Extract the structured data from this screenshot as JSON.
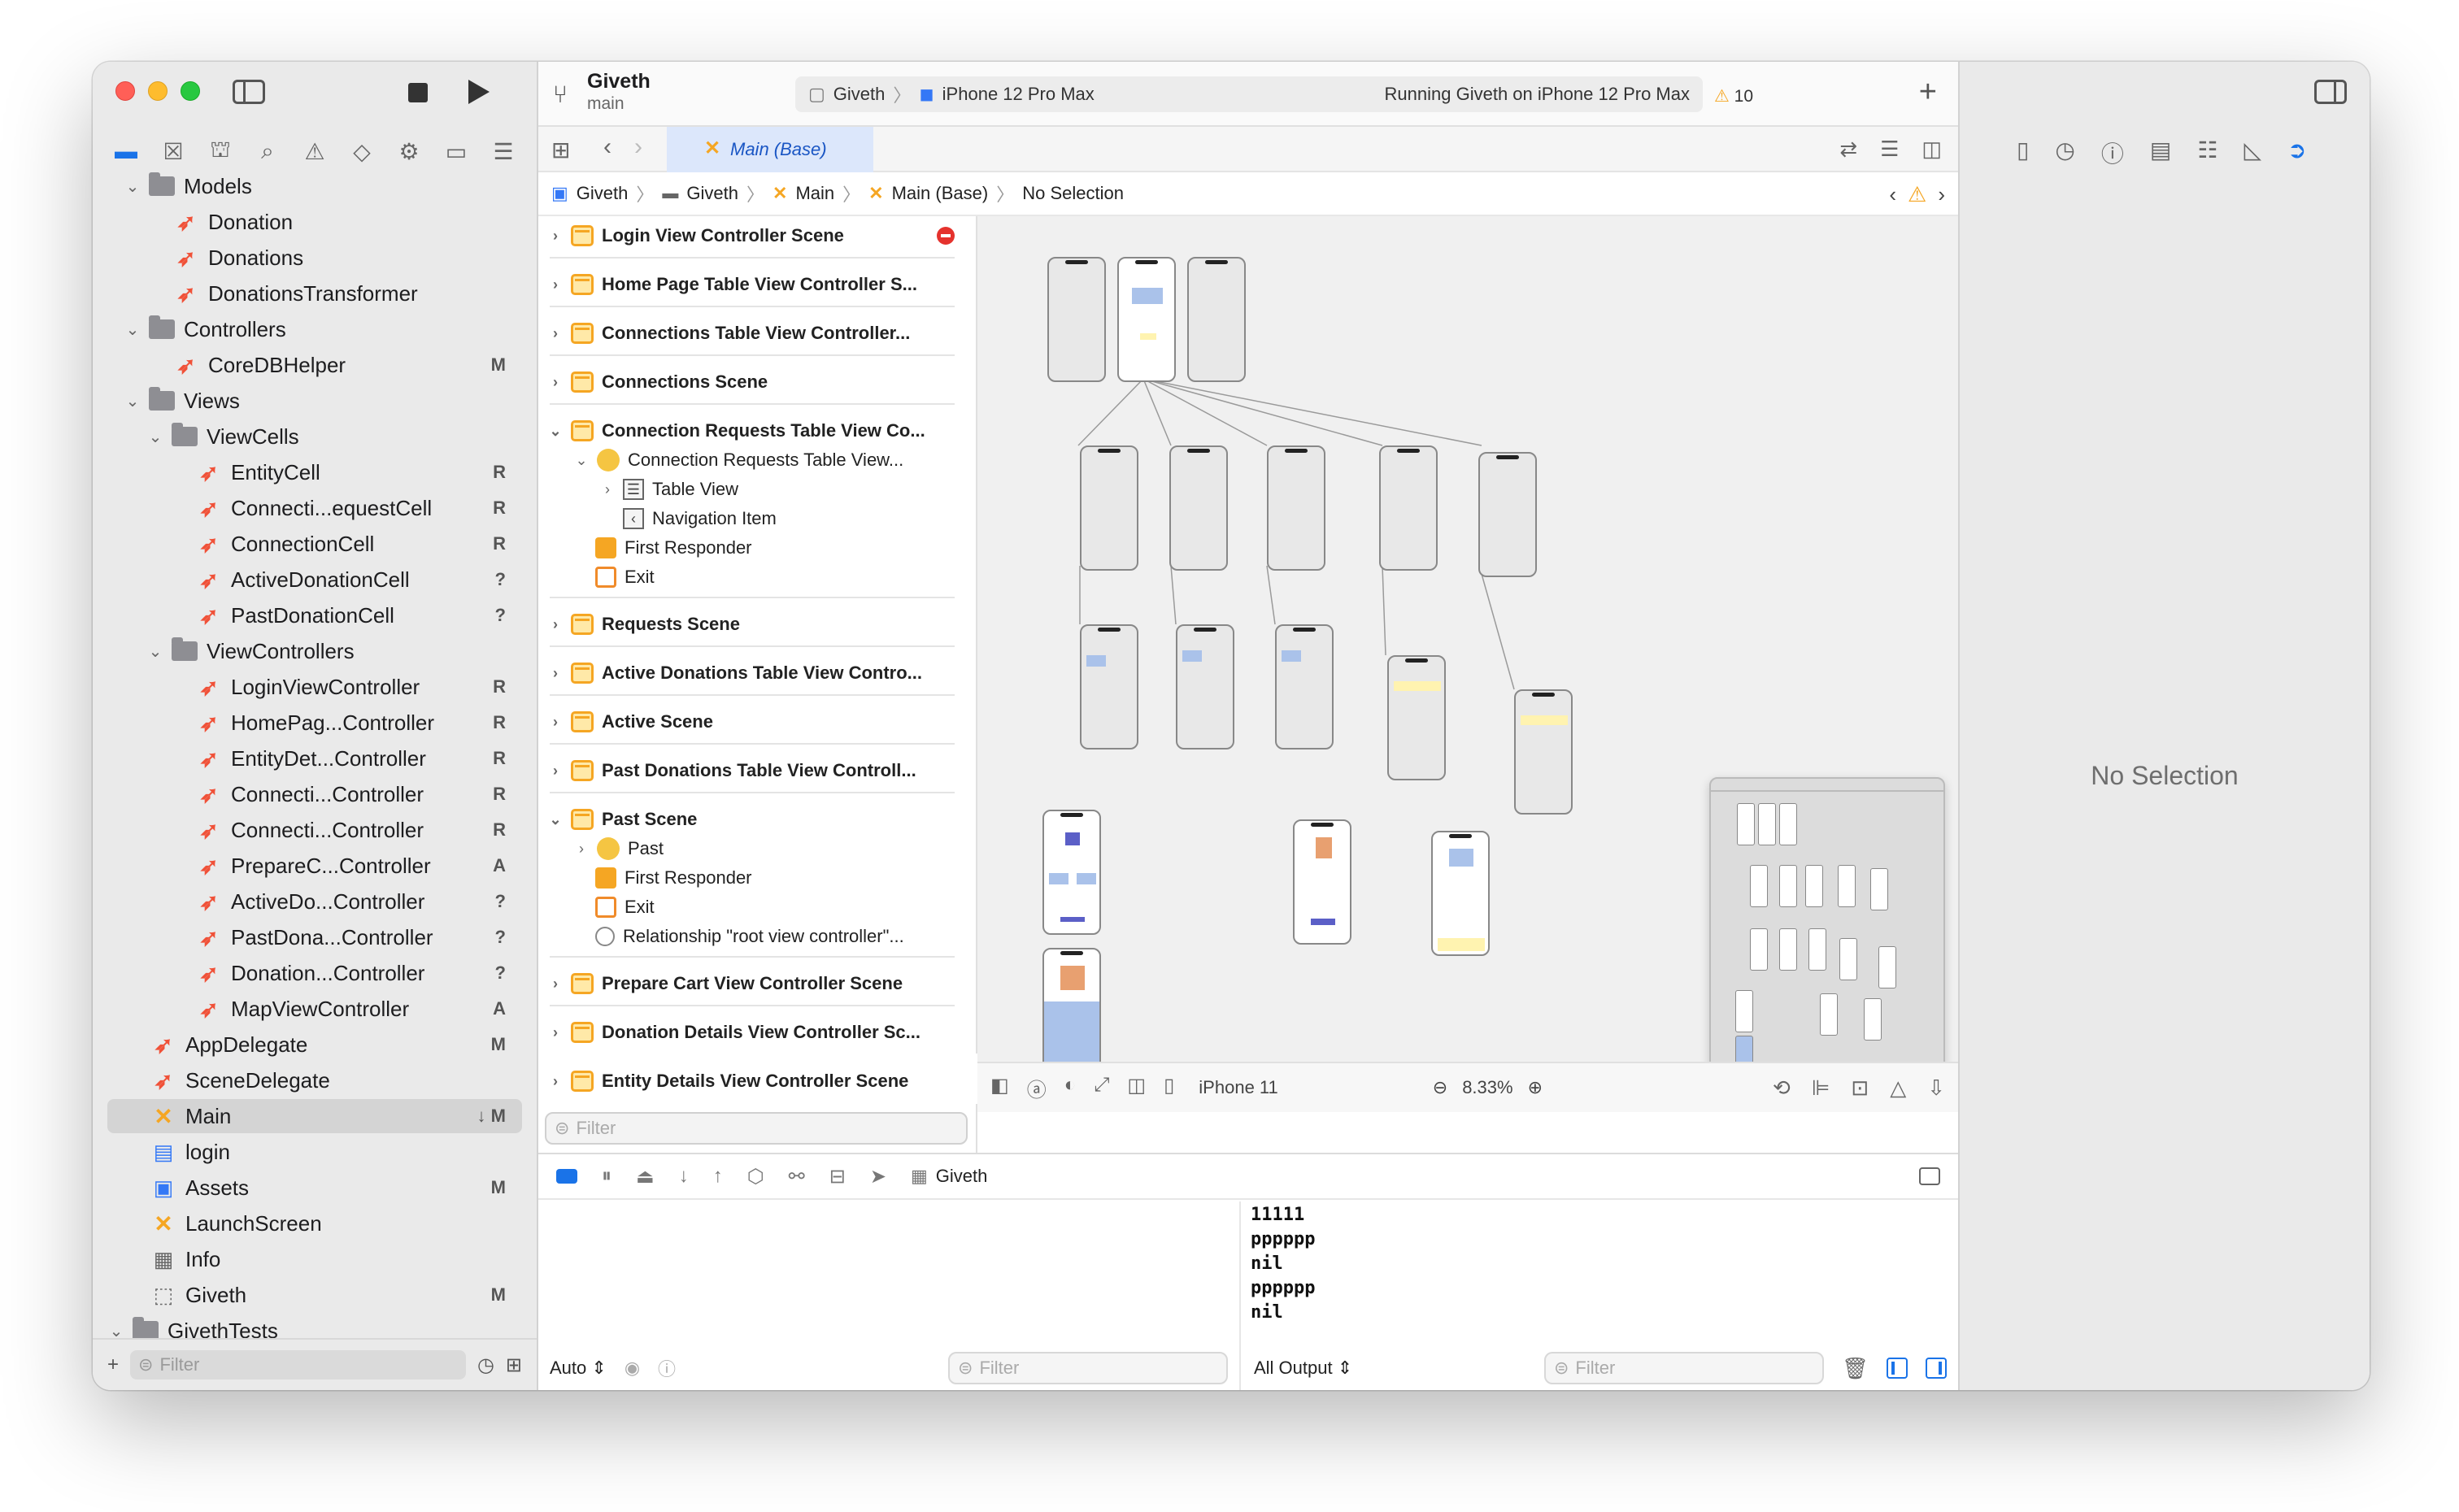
{
  "toolbar": {
    "project_name": "Giveth",
    "branch": "main",
    "scheme": "Giveth",
    "device": "iPhone 12 Pro Max",
    "status": "Running Giveth on iPhone 12 Pro Max",
    "warning_count": "10"
  },
  "navigator": {
    "filter_placeholder": "Filter",
    "items": [
      {
        "label": "Models",
        "kind": "folder",
        "indent": 1,
        "expanded": true,
        "badge": ""
      },
      {
        "label": "Donation",
        "kind": "swift",
        "indent": 2,
        "badge": ""
      },
      {
        "label": "Donations",
        "kind": "swift",
        "indent": 2,
        "badge": ""
      },
      {
        "label": "DonationsTransformer",
        "kind": "swift",
        "indent": 2,
        "badge": ""
      },
      {
        "label": "Controllers",
        "kind": "folder",
        "indent": 1,
        "expanded": true,
        "badge": ""
      },
      {
        "label": "CoreDBHelper",
        "kind": "swift",
        "indent": 2,
        "badge": "M"
      },
      {
        "label": "Views",
        "kind": "folder",
        "indent": 1,
        "expanded": true,
        "badge": ""
      },
      {
        "label": "ViewCells",
        "kind": "folder",
        "indent": 2,
        "expanded": true,
        "badge": ""
      },
      {
        "label": "EntityCell",
        "kind": "swift",
        "indent": 3,
        "badge": "R"
      },
      {
        "label": "Connecti...equestCell",
        "kind": "swift",
        "indent": 3,
        "badge": "R"
      },
      {
        "label": "ConnectionCell",
        "kind": "swift",
        "indent": 3,
        "badge": "R"
      },
      {
        "label": "ActiveDonationCell",
        "kind": "swift",
        "indent": 3,
        "badge": "?"
      },
      {
        "label": "PastDonationCell",
        "kind": "swift",
        "indent": 3,
        "badge": "?"
      },
      {
        "label": "ViewControllers",
        "kind": "folder",
        "indent": 2,
        "expanded": true,
        "badge": ""
      },
      {
        "label": "LoginViewController",
        "kind": "swift",
        "indent": 3,
        "badge": "R"
      },
      {
        "label": "HomePag...Controller",
        "kind": "swift",
        "indent": 3,
        "badge": "R"
      },
      {
        "label": "EntityDet...Controller",
        "kind": "swift",
        "indent": 3,
        "badge": "R"
      },
      {
        "label": "Connecti...Controller",
        "kind": "swift",
        "indent": 3,
        "badge": "R"
      },
      {
        "label": "Connecti...Controller",
        "kind": "swift",
        "indent": 3,
        "badge": "R"
      },
      {
        "label": "PrepareC...Controller",
        "kind": "swift",
        "indent": 3,
        "badge": "A"
      },
      {
        "label": "ActiveDo...Controller",
        "kind": "swift",
        "indent": 3,
        "badge": "?"
      },
      {
        "label": "PastDona...Controller",
        "kind": "swift",
        "indent": 3,
        "badge": "?"
      },
      {
        "label": "Donation...Controller",
        "kind": "swift",
        "indent": 3,
        "badge": "?"
      },
      {
        "label": "MapViewController",
        "kind": "swift",
        "indent": 3,
        "badge": "A"
      },
      {
        "label": "AppDelegate",
        "kind": "swift",
        "indent": 1,
        "badge": "M"
      },
      {
        "label": "SceneDelegate",
        "kind": "swift",
        "indent": 1,
        "badge": ""
      },
      {
        "label": "Main",
        "kind": "storyboard",
        "indent": 1,
        "badge": "↓ M",
        "selected": true
      },
      {
        "label": "login",
        "kind": "xib",
        "indent": 1,
        "badge": ""
      },
      {
        "label": "Assets",
        "kind": "assets",
        "indent": 1,
        "badge": "M"
      },
      {
        "label": "LaunchScreen",
        "kind": "storyboard",
        "indent": 1,
        "badge": ""
      },
      {
        "label": "Info",
        "kind": "plist",
        "indent": 1,
        "badge": ""
      },
      {
        "label": "Giveth",
        "kind": "coredata",
        "indent": 1,
        "badge": "M"
      },
      {
        "label": "GivethTests",
        "kind": "folder",
        "indent": 0,
        "expanded": true,
        "badge": ""
      }
    ]
  },
  "editor": {
    "tab_label": "Main (Base)",
    "jumpbar": [
      "Giveth",
      "Giveth",
      "Main",
      "Main (Base)",
      "No Selection"
    ],
    "outline": [
      {
        "label": "Login View Controller Scene",
        "type": "scene",
        "level": 0,
        "error": true
      },
      {
        "label": "Home Page Table View Controller S...",
        "type": "scene",
        "level": 0
      },
      {
        "label": "Connections Table View Controller...",
        "type": "scene",
        "level": 0
      },
      {
        "label": "Connections Scene",
        "type": "scene",
        "level": 0
      },
      {
        "label": "Connection Requests Table View Co...",
        "type": "scene",
        "level": 0,
        "expanded": true
      },
      {
        "label": "Connection Requests Table View...",
        "type": "vc",
        "level": 1,
        "expanded": true
      },
      {
        "label": "Table View",
        "type": "table",
        "level": 2,
        "collapsed": true
      },
      {
        "label": "Navigation Item",
        "type": "navitem",
        "level": 2
      },
      {
        "label": "First Responder",
        "type": "responder",
        "level": 1
      },
      {
        "label": "Exit",
        "type": "exit",
        "level": 1
      },
      {
        "label": "Requests Scene",
        "type": "scene",
        "level": 0
      },
      {
        "label": "Active Donations Table View Contro...",
        "type": "scene",
        "level": 0
      },
      {
        "label": "Active Scene",
        "type": "scene",
        "level": 0
      },
      {
        "label": "Past Donations Table View Controll...",
        "type": "scene",
        "level": 0
      },
      {
        "label": "Past Scene",
        "type": "scene",
        "level": 0,
        "expanded": true
      },
      {
        "label": "Past",
        "type": "vc",
        "level": 1,
        "collapsed": true
      },
      {
        "label": "First Responder",
        "type": "responder",
        "level": 1
      },
      {
        "label": "Exit",
        "type": "exit",
        "level": 1
      },
      {
        "label": "Relationship \"root view controller\"...",
        "type": "relationship",
        "level": 1
      },
      {
        "label": "Prepare Cart View Controller Scene",
        "type": "scene",
        "level": 0
      },
      {
        "label": "Donation Details View Controller Sc...",
        "type": "scene",
        "level": 0
      },
      {
        "label": "Entity Details View Controller Scene",
        "type": "scene",
        "level": 0
      }
    ],
    "outline_filter_placeholder": "Filter",
    "device_config": "iPhone 11",
    "zoom_level": "8.33%"
  },
  "debug": {
    "target": "Giveth",
    "console_lines": [
      "11111",
      "pppppp",
      "nil",
      "pppppp",
      "nil"
    ],
    "auto_label": "Auto",
    "output_label": "All Output",
    "filter_placeholder": "Filter"
  },
  "inspector": {
    "empty_text": "No Selection"
  },
  "colors": {
    "accent": "#1a73e8",
    "swift": "#f05138",
    "storyboard": "#f5a623",
    "error": "#e5322d"
  }
}
